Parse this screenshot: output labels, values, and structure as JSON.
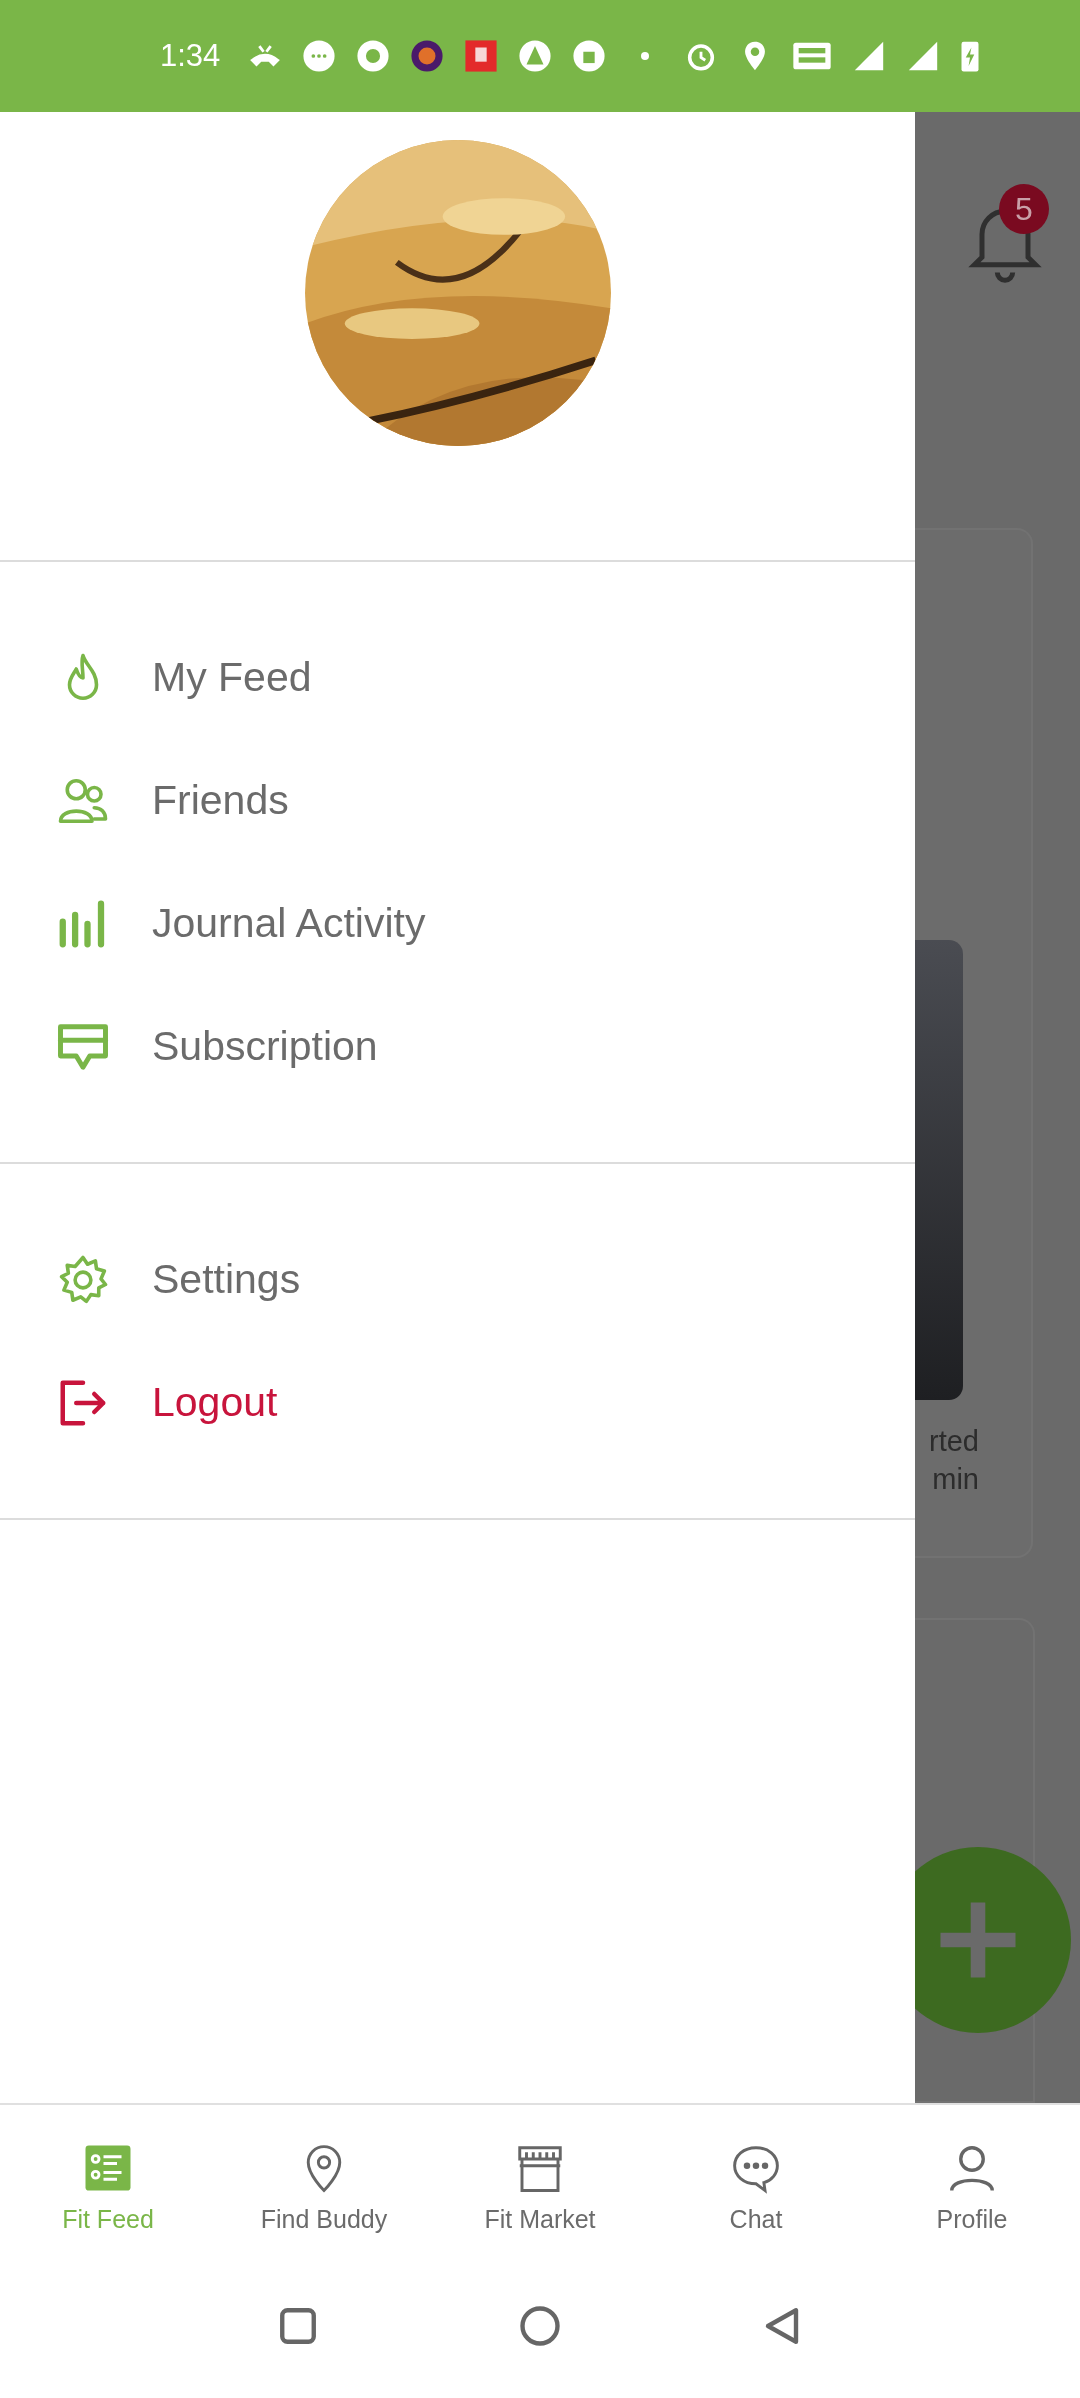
{
  "status_bar": {
    "time": "1:34"
  },
  "background": {
    "notification_count": "5",
    "card_lines": [
      "rted",
      "min"
    ]
  },
  "drawer": {
    "sections": [
      [
        {
          "label": "My Feed",
          "kind": "default"
        },
        {
          "label": "Friends",
          "kind": "default"
        },
        {
          "label": "Journal Activity",
          "kind": "default"
        },
        {
          "label": "Subscription",
          "kind": "default"
        }
      ],
      [
        {
          "label": "Settings",
          "kind": "default"
        },
        {
          "label": "Logout",
          "kind": "danger"
        }
      ]
    ]
  },
  "bottom_nav": [
    {
      "label": "Fit Feed",
      "selected": true
    },
    {
      "label": "Find Buddy",
      "selected": false
    },
    {
      "label": "Fit Market",
      "selected": false
    },
    {
      "label": "Chat",
      "selected": false
    },
    {
      "label": "Profile",
      "selected": false
    }
  ]
}
